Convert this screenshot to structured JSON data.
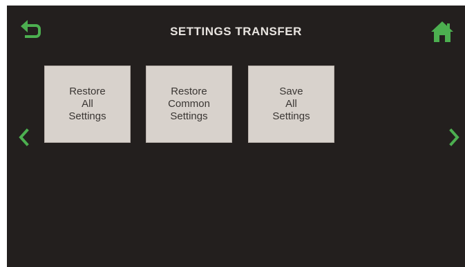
{
  "header": {
    "title": "SETTINGS TRANSFER",
    "back_icon": "back-arrow-icon",
    "home_icon": "home-icon"
  },
  "tiles": [
    {
      "label": "Restore\nAll\nSettings"
    },
    {
      "label": "Restore\nCommon\nSettings"
    },
    {
      "label": "Save\nAll\nSettings"
    }
  ],
  "nav": {
    "prev_icon": "chevron-left-icon",
    "next_icon": "chevron-right-icon"
  },
  "colors": {
    "background": "#231f1e",
    "accent": "#4caf50",
    "tile": "#d8d2cc",
    "title_text": "#e8e4e0",
    "tile_text": "#3a3633"
  }
}
